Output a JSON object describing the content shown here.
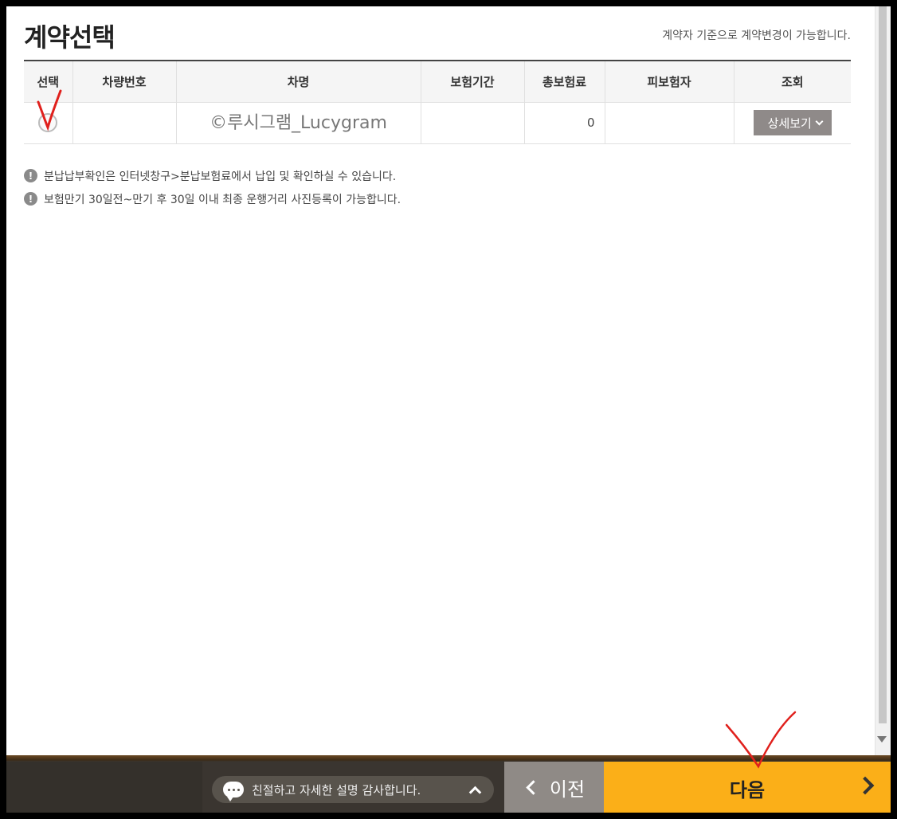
{
  "page": {
    "title": "계약선택",
    "note": "계약자 기준으로 계약변경이 가능합니다."
  },
  "table": {
    "headers": [
      "선택",
      "차량번호",
      "차명",
      "보험기간",
      "총보험료",
      "피보험자",
      "조회"
    ],
    "row": {
      "vehicle_number": "",
      "car_name_watermark": "©루시그램_Lucygram",
      "insurance_period": "",
      "total_premium": "0",
      "insured": "",
      "detail_button": "상세보기"
    }
  },
  "notices": [
    "분납납부확인은 인터넷창구>분납보험료에서 납입 및 확인하실 수 있습니다.",
    "보험만기 30일전~만기 후 30일 이내 최종 운행거리 사진등록이 가능합니다."
  ],
  "footer": {
    "help_text": "친절하고 자세한 설명 감사합니다.",
    "prev_label": "이전",
    "next_label": "다음"
  },
  "icons": {
    "notice": "exclamation-circle-icon",
    "chat": "chat-bubble-icon",
    "collapse": "chevron-up-icon",
    "prev": "chevron-left-icon",
    "next": "chevron-right-icon",
    "dropdown": "chevron-down-icon"
  },
  "colors": {
    "next_button": "#fbaf18",
    "prev_button": "#8f8a86",
    "detail_button": "#8f8a89",
    "annotation_marks": "#e0201c"
  }
}
